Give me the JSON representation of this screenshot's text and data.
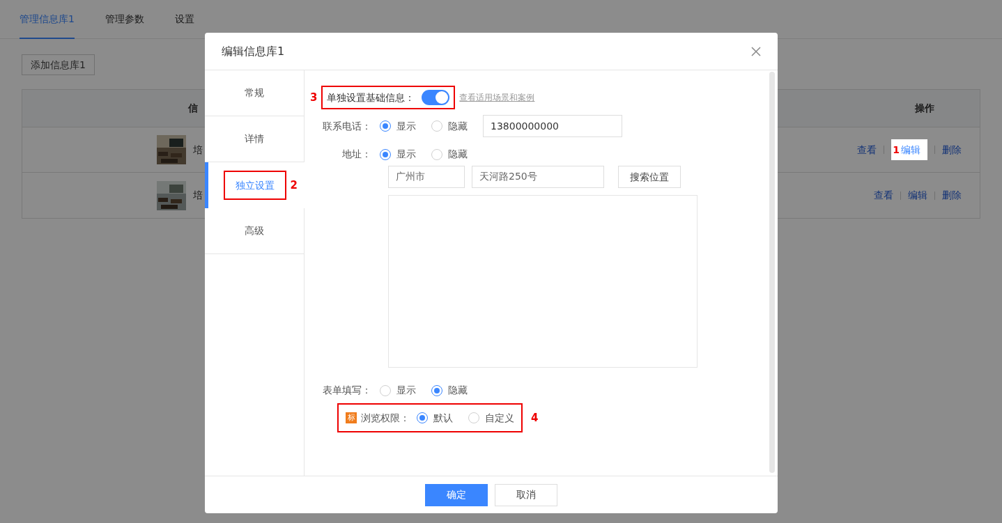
{
  "page": {
    "tabs": [
      {
        "label": "管理信息库1",
        "selected": true
      },
      {
        "label": "管理参数",
        "selected": false
      },
      {
        "label": "设置",
        "selected": false
      }
    ],
    "add_button": "添加信息库1",
    "table": {
      "columns": [
        "信",
        "操作"
      ],
      "rows": [
        {
          "name": "培",
          "actions": [
            {
              "label": "查看",
              "highlighted": false
            },
            {
              "label": "编辑",
              "highlighted": true,
              "annotation": "1"
            },
            {
              "label": "删除",
              "highlighted": false
            }
          ]
        },
        {
          "name": "培",
          "actions": [
            {
              "label": "查看",
              "highlighted": false
            },
            {
              "label": "编辑",
              "highlighted": false
            },
            {
              "label": "删除",
              "highlighted": false
            }
          ]
        }
      ]
    }
  },
  "dialog": {
    "title": "编辑信息库1",
    "side_tabs": [
      {
        "label": "常规",
        "selected": false
      },
      {
        "label": "详情",
        "selected": false
      },
      {
        "label": "独立设置",
        "selected": true,
        "annotation": "2"
      },
      {
        "label": "高级",
        "selected": false
      }
    ],
    "toggle": {
      "label": "单独设置基础信息：",
      "on": true,
      "annotation": "3",
      "link": "查看适用场景和案例"
    },
    "phone": {
      "label": "联系电话：",
      "options": [
        {
          "label": "显示",
          "selected": true
        },
        {
          "label": "隐藏",
          "selected": false
        }
      ],
      "value": "13800000000"
    },
    "address": {
      "label": "地址：",
      "options": [
        {
          "label": "显示",
          "selected": true
        },
        {
          "label": "隐藏",
          "selected": false
        }
      ],
      "city": "广州市",
      "street": "天河路250号",
      "search_button": "搜索位置"
    },
    "form_fill": {
      "label": "表单填写：",
      "options": [
        {
          "label": "显示",
          "selected": false
        },
        {
          "label": "隐藏",
          "selected": true
        }
      ]
    },
    "permission": {
      "badge": "标",
      "label": "浏览权限：",
      "annotation": "4",
      "options": [
        {
          "label": "默认",
          "selected": true
        },
        {
          "label": "自定义",
          "selected": false
        }
      ]
    },
    "buttons": [
      {
        "label": "确定",
        "primary": true
      },
      {
        "label": "取消",
        "primary": false
      }
    ]
  }
}
